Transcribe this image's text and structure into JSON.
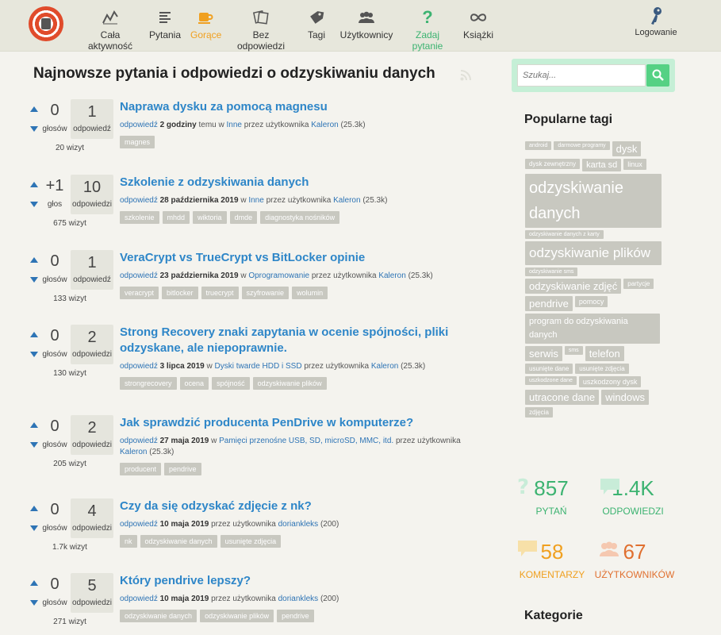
{
  "nav": [
    {
      "label": "Cała aktywność",
      "icon": "activity-icon"
    },
    {
      "label": "Pytania",
      "icon": "list-icon"
    },
    {
      "label": "Gorące",
      "icon": "hot-cup-icon"
    },
    {
      "label": "Bez odpowiedzi",
      "icon": "unanswered-icon"
    },
    {
      "label": "Tagi",
      "icon": "tag-icon"
    },
    {
      "label": "Użytkownicy",
      "icon": "users-icon"
    },
    {
      "label": "Zadaj pytanie",
      "icon": "question-icon"
    },
    {
      "label": "Książki",
      "icon": "infinity-icon"
    }
  ],
  "login_label": "Logowanie",
  "page_title": "Najnowsze pytania i odpowiedzi o odzyskiwaniu danych",
  "questions": [
    {
      "votes": "0",
      "votes_label": "głosów",
      "answers": "1",
      "answers_label": "odpowiedź",
      "views": "20 wizyt",
      "title": "Naprawa dysku za pomocą magnesu",
      "action": "odpowiedź",
      "when": "2 godziny",
      "when_suffix": "temu w",
      "category": "Inne",
      "by": "przez użytkownika",
      "user": "Kaleron",
      "points": "(25.3k)",
      "tags": [
        "magnes"
      ]
    },
    {
      "votes": "+1",
      "votes_label": "głos",
      "answers": "10",
      "answers_label": "odpowiedzi",
      "views": "675 wizyt",
      "title": "Szkolenie z odzyskiwania danych",
      "action": "odpowiedź",
      "when": "28 października 2019",
      "when_suffix": "w",
      "category": "Inne",
      "by": "przez użytkownika",
      "user": "Kaleron",
      "points": "(25.3k)",
      "tags": [
        "szkolenie",
        "mhdd",
        "wiktoria",
        "dmde",
        "diagnostyka nośników"
      ]
    },
    {
      "votes": "0",
      "votes_label": "głosów",
      "answers": "1",
      "answers_label": "odpowiedź",
      "views": "133 wizyt",
      "title": "VeraCrypt vs TrueCrypt vs BitLocker opinie",
      "action": "odpowiedź",
      "when": "23 października 2019",
      "when_suffix": "w",
      "category": "Oprogramowanie",
      "by": "przez użytkownika",
      "user": "Kaleron",
      "points": "(25.3k)",
      "tags": [
        "veracrypt",
        "bitlocker",
        "truecrypt",
        "szyfrowanie",
        "wolumin"
      ]
    },
    {
      "votes": "0",
      "votes_label": "głosów",
      "answers": "2",
      "answers_label": "odpowiedzi",
      "views": "130 wizyt",
      "title": "Strong Recovery znaki zapytania w ocenie spójności, pliki odzyskane, ale niepoprawnie.",
      "action": "odpowiedź",
      "when": "3 lipca 2019",
      "when_suffix": "w",
      "category": "Dyski twarde HDD i SSD",
      "by": "przez użytkownika",
      "user": "Kaleron",
      "points": "(25.3k)",
      "tags": [
        "strongrecovery",
        "ocena",
        "spójność",
        "odzyskiwanie plików"
      ]
    },
    {
      "votes": "0",
      "votes_label": "głosów",
      "answers": "2",
      "answers_label": "odpowiedzi",
      "views": "205 wizyt",
      "title": "Jak sprawdzić producenta PenDrive w komputerze?",
      "action": "odpowiedź",
      "when": "27 maja 2019",
      "when_suffix": "w",
      "category": "Pamięci przenośne USB, SD, microSD, MMC, itd.",
      "by": "przez użytkownika",
      "user": "Kaleron",
      "points": "(25.3k)",
      "tags": [
        "producent",
        "pendrive"
      ]
    },
    {
      "votes": "0",
      "votes_label": "głosów",
      "answers": "4",
      "answers_label": "odpowiedzi",
      "views": "1.7k wizyt",
      "title": "Czy da się odzyskać zdjęcie z nk?",
      "action": "odpowiedź",
      "when": "10 maja 2019",
      "when_suffix": "",
      "category": "",
      "by": "przez użytkownika",
      "user": "doriankleks",
      "points": "(200)",
      "tags": [
        "nk",
        "odzyskiwanie danych",
        "usunięte zdjęcia"
      ]
    },
    {
      "votes": "0",
      "votes_label": "głosów",
      "answers": "5",
      "answers_label": "odpowiedzi",
      "views": "271 wizyt",
      "title": "Który pendrive lepszy?",
      "action": "odpowiedź",
      "when": "10 maja 2019",
      "when_suffix": "",
      "category": "",
      "by": "przez użytkownika",
      "user": "doriankleks",
      "points": "(200)",
      "tags": [
        "odzyskiwanie danych",
        "odzyskiwanie plików",
        "pendrive"
      ]
    }
  ],
  "search": {
    "placeholder": "Szukaj..."
  },
  "sidebar": {
    "popular_tags_title": "Popularne tagi",
    "categories_title": "Kategorie",
    "tag_cloud": [
      {
        "label": "android",
        "size": "s7"
      },
      {
        "label": "darmowe programy",
        "size": "s7"
      },
      {
        "label": "dysk",
        "size": "s13"
      },
      {
        "label": "dysk zewnętrzny",
        "size": "s8"
      },
      {
        "label": "karta sd",
        "size": "s11"
      },
      {
        "label": "linux",
        "size": "s9"
      },
      {
        "label": "odzyskiwanie danych",
        "size": "s21"
      },
      {
        "label": "odzyskiwanie danych z karty",
        "size": "s7"
      },
      {
        "label": "odzyskiwanie plików",
        "size": "s17w"
      },
      {
        "label": "odzyskiwanie sms",
        "size": "s7"
      },
      {
        "label": "odzyskiwanie zdjęć",
        "size": "s13"
      },
      {
        "label": "partycje",
        "size": "s8"
      },
      {
        "label": "pendrive",
        "size": "s13"
      },
      {
        "label": "pomocy",
        "size": "s9"
      },
      {
        "label": "program do odzyskiwania danych",
        "size": "s11w"
      },
      {
        "label": "serwis",
        "size": "s13"
      },
      {
        "label": "sms",
        "size": "s7"
      },
      {
        "label": "telefon",
        "size": "s13"
      },
      {
        "label": "usunięte dane",
        "size": "s8"
      },
      {
        "label": "usunięte zdjęcia",
        "size": "s8"
      },
      {
        "label": "uszkodzone dane",
        "size": "s7"
      },
      {
        "label": "uszkodzony dysk",
        "size": "s9"
      },
      {
        "label": "utracone dane",
        "size": "s13"
      },
      {
        "label": "windows",
        "size": "s13"
      },
      {
        "label": "zdjęcia",
        "size": "s8"
      }
    ],
    "stats": [
      {
        "value": "857",
        "label": "PYTAŃ",
        "color": "#3cb371"
      },
      {
        "value": "1.4K",
        "label": "ODPOWIEDZI",
        "color": "#3cb371"
      },
      {
        "value": "58",
        "label": "KOMENTARZY",
        "color": "#f0a020"
      },
      {
        "value": "67",
        "label": "UŻYTKOWNIKÓW",
        "color": "#e07030"
      }
    ]
  }
}
